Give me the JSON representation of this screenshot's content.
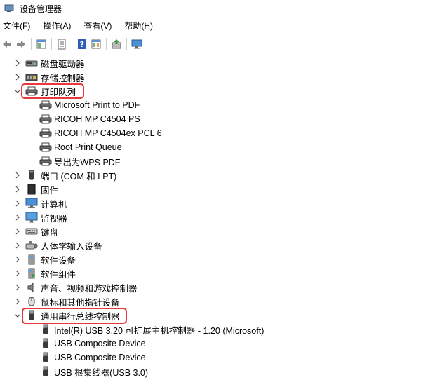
{
  "window": {
    "title": "设备管理器"
  },
  "menu": [
    "文件(F)",
    "操作(A)",
    "查看(V)",
    "帮助(H)"
  ],
  "toolbar": [
    "back-icon",
    "forward-icon",
    "show-hide-tree-icon",
    "properties-icon",
    "help-icon",
    "view-icon",
    "update-driver-icon",
    "monitor-icon"
  ],
  "tree": {
    "categories": [
      {
        "label": "磁盘驱动器",
        "icon": "disk-drive-icon",
        "expanded": false
      },
      {
        "label": "存储控制器",
        "icon": "storage-controller-icon",
        "expanded": false
      },
      {
        "label": "打印队列",
        "icon": "printer-icon",
        "expanded": true,
        "selected": true,
        "children": [
          "Microsoft Print to PDF",
          "RICOH MP C4504 PS",
          "RICOH MP C4504ex PCL 6",
          "Root Print Queue",
          "导出为WPS PDF"
        ]
      },
      {
        "label": "端口 (COM 和 LPT)",
        "icon": "port-icon",
        "expanded": false
      },
      {
        "label": "固件",
        "icon": "firmware-icon",
        "expanded": false
      },
      {
        "label": "计算机",
        "icon": "computer-icon",
        "expanded": false
      },
      {
        "label": "监视器",
        "icon": "monitor-icon",
        "expanded": false
      },
      {
        "label": "键盘",
        "icon": "keyboard-icon",
        "expanded": false
      },
      {
        "label": "人体学输入设备",
        "icon": "hid-icon",
        "expanded": false
      },
      {
        "label": "软件设备",
        "icon": "software-device-icon",
        "expanded": false
      },
      {
        "label": "软件组件",
        "icon": "software-component-icon",
        "expanded": false
      },
      {
        "label": "声音、视频和游戏控制器",
        "icon": "speaker-icon",
        "expanded": false
      },
      {
        "label": "鼠标和其他指针设备",
        "icon": "mouse-icon",
        "expanded": false
      },
      {
        "label": "通用串行总线控制器",
        "icon": "usb-icon",
        "expanded": true,
        "selected": true,
        "children": [
          "Intel(R) USB 3.20 可扩展主机控制器 - 1.20 (Microsoft)",
          "USB Composite Device",
          "USB Composite Device",
          "USB 根集线器(USB 3.0)"
        ]
      }
    ]
  }
}
